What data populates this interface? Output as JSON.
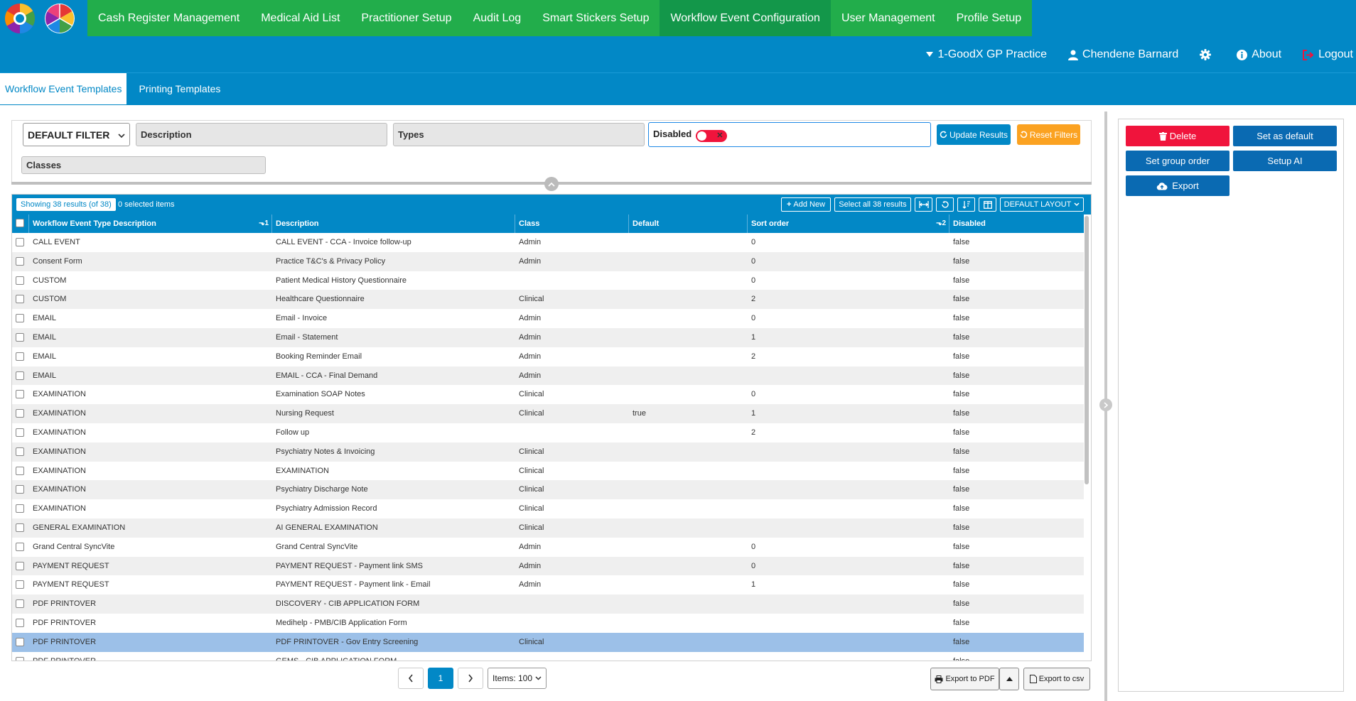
{
  "nav": {
    "items": [
      {
        "label": "Cash Register Management"
      },
      {
        "label": "Medical Aid List"
      },
      {
        "label": "Practitioner Setup"
      },
      {
        "label": "Audit Log"
      },
      {
        "label": "Smart Stickers Setup"
      },
      {
        "label": "Workflow Event Configuration",
        "active": true
      },
      {
        "label": "User Management"
      },
      {
        "label": "Profile Setup"
      }
    ]
  },
  "user_nav": {
    "practice": "1-GoodX GP Practice",
    "user": "Chendene Barnard",
    "about": "About",
    "logout": "Logout"
  },
  "sub_tabs": [
    {
      "label": "Workflow Event Templates",
      "active": true
    },
    {
      "label": "Printing Templates"
    }
  ],
  "filters": {
    "filter_select": "DEFAULT FILTER",
    "description": "Description",
    "types": "Types",
    "disabled_label": "Disabled",
    "disabled_value": false,
    "classes": "Classes",
    "update_results": "Update Results",
    "reset_filters": "Reset Filters"
  },
  "grid": {
    "results_text": "Showing 38 results (of 38)",
    "selected_text": "0 selected items",
    "add_new": "Add New",
    "select_all": "Select all 38 results",
    "layout": "DEFAULT LAYOUT",
    "columns": [
      "Workflow Event Type Description",
      "Description",
      "Class",
      "Default",
      "Sort order",
      "Disabled"
    ],
    "sort_marks": [
      "1",
      "2"
    ],
    "rows": [
      {
        "type": "CALL EVENT",
        "desc": "CALL EVENT - CCA - Invoice follow-up",
        "class": "Admin",
        "default": "",
        "sort": "0",
        "disabled": "false"
      },
      {
        "type": "Consent Form",
        "desc": "Practice T&C's & Privacy Policy",
        "class": "Admin",
        "default": "",
        "sort": "0",
        "disabled": "false"
      },
      {
        "type": "CUSTOM",
        "desc": "Patient Medical History Questionnaire",
        "class": "",
        "default": "",
        "sort": "0",
        "disabled": "false"
      },
      {
        "type": "CUSTOM",
        "desc": "Healthcare Questionnaire",
        "class": "Clinical",
        "default": "",
        "sort": "2",
        "disabled": "false"
      },
      {
        "type": "EMAIL",
        "desc": "Email - Invoice",
        "class": "Admin",
        "default": "",
        "sort": "0",
        "disabled": "false"
      },
      {
        "type": "EMAIL",
        "desc": "Email - Statement",
        "class": "Admin",
        "default": "",
        "sort": "1",
        "disabled": "false"
      },
      {
        "type": "EMAIL",
        "desc": "Booking Reminder Email",
        "class": "Admin",
        "default": "",
        "sort": "2",
        "disabled": "false"
      },
      {
        "type": "EMAIL",
        "desc": "EMAIL - CCA - Final Demand",
        "class": "Admin",
        "default": "",
        "sort": "",
        "disabled": "false"
      },
      {
        "type": "EXAMINATION",
        "desc": "Examination SOAP Notes",
        "class": "Clinical",
        "default": "",
        "sort": "0",
        "disabled": "false"
      },
      {
        "type": "EXAMINATION",
        "desc": "Nursing Request",
        "class": "Clinical",
        "default": "true",
        "sort": "1",
        "disabled": "false"
      },
      {
        "type": "EXAMINATION",
        "desc": "Follow up",
        "class": "",
        "default": "",
        "sort": "2",
        "disabled": "false"
      },
      {
        "type": "EXAMINATION",
        "desc": "Psychiatry Notes & Invoicing",
        "class": "Clinical",
        "default": "",
        "sort": "",
        "disabled": "false"
      },
      {
        "type": "EXAMINATION",
        "desc": "EXAMINATION",
        "class": "Clinical",
        "default": "",
        "sort": "",
        "disabled": "false"
      },
      {
        "type": "EXAMINATION",
        "desc": "Psychiatry Discharge Note",
        "class": "Clinical",
        "default": "",
        "sort": "",
        "disabled": "false"
      },
      {
        "type": "EXAMINATION",
        "desc": "Psychiatry Admission Record",
        "class": "Clinical",
        "default": "",
        "sort": "",
        "disabled": "false"
      },
      {
        "type": "GENERAL EXAMINATION",
        "desc": "AI GENERAL EXAMINATION",
        "class": "Clinical",
        "default": "",
        "sort": "",
        "disabled": "false"
      },
      {
        "type": "Grand Central SyncVite",
        "desc": "Grand Central SyncVite",
        "class": "Admin",
        "default": "",
        "sort": "0",
        "disabled": "false"
      },
      {
        "type": "PAYMENT REQUEST",
        "desc": "PAYMENT REQUEST - Payment link SMS",
        "class": "Admin",
        "default": "",
        "sort": "0",
        "disabled": "false"
      },
      {
        "type": "PAYMENT REQUEST",
        "desc": "PAYMENT REQUEST - Payment link - Email",
        "class": "Admin",
        "default": "",
        "sort": "1",
        "disabled": "false"
      },
      {
        "type": "PDF PRINTOVER",
        "desc": "DISCOVERY - CIB APPLICATION FORM",
        "class": "",
        "default": "",
        "sort": "",
        "disabled": "false"
      },
      {
        "type": "PDF PRINTOVER",
        "desc": "Medihelp - PMB/CIB Application Form",
        "class": "",
        "default": "",
        "sort": "",
        "disabled": "false"
      },
      {
        "type": "PDF PRINTOVER",
        "desc": "PDF PRINTOVER - Gov Entry Screening",
        "class": "Clinical",
        "default": "",
        "sort": "",
        "disabled": "false",
        "selected": true
      },
      {
        "type": "PDF PRINTOVER",
        "desc": "GEMS - CIB APPLICATION FORM",
        "class": "",
        "default": "",
        "sort": "",
        "disabled": "false"
      }
    ]
  },
  "pager": {
    "current_page": "1",
    "items_per_page": "Items: 100",
    "export_pdf": "Export to PDF",
    "export_csv": "Export to csv"
  },
  "side_panel": {
    "delete": "Delete",
    "set_default": "Set as default",
    "set_group_order": "Set group order",
    "setup_ai": "Setup AI",
    "export": "Export"
  },
  "colors": {
    "primary": "#0288c6",
    "nav_green": "#22ad4b",
    "nav_active": "#13974a",
    "danger": "#f0143c",
    "warning": "#fba221",
    "selected_row": "#9cc0e8"
  },
  "icons": [
    "logo-wheel",
    "caret-down-icon",
    "user-icon",
    "gear-icon",
    "info-icon",
    "logout-icon",
    "refresh-icon",
    "undo-icon",
    "plus-icon",
    "fit-columns-icon",
    "sort-icon",
    "columns-icon",
    "chevron-up-icon",
    "chevron-right-icon",
    "chevron-left-icon",
    "printer-icon",
    "file-icon",
    "trash-icon",
    "cloud-upload-icon"
  ]
}
